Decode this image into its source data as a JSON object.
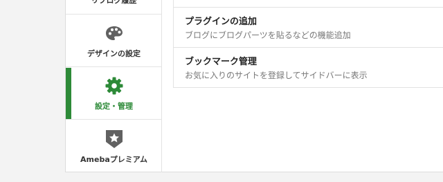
{
  "sidebar": {
    "items": [
      {
        "label": "リブログ履歴",
        "icon": "reblog-history-icon"
      },
      {
        "label": "デザインの設定",
        "icon": "palette-icon"
      },
      {
        "label": "設定・管理",
        "icon": "gear-icon",
        "active": true
      },
      {
        "label": "Amebaプレミアム",
        "icon": "premium-star-badge-icon"
      }
    ]
  },
  "main": {
    "rows": [
      {
        "title": "プラグインの追加",
        "description": "ブログにブログパーツを貼るなどの機能追加"
      },
      {
        "title": "ブックマーク管理",
        "description": "お気に入りのサイトを登録してサイドバーに表示"
      }
    ]
  },
  "colors": {
    "accent": "#2d8a38",
    "icon_gray": "#616161",
    "text": "#333333",
    "subtext": "#777777"
  }
}
